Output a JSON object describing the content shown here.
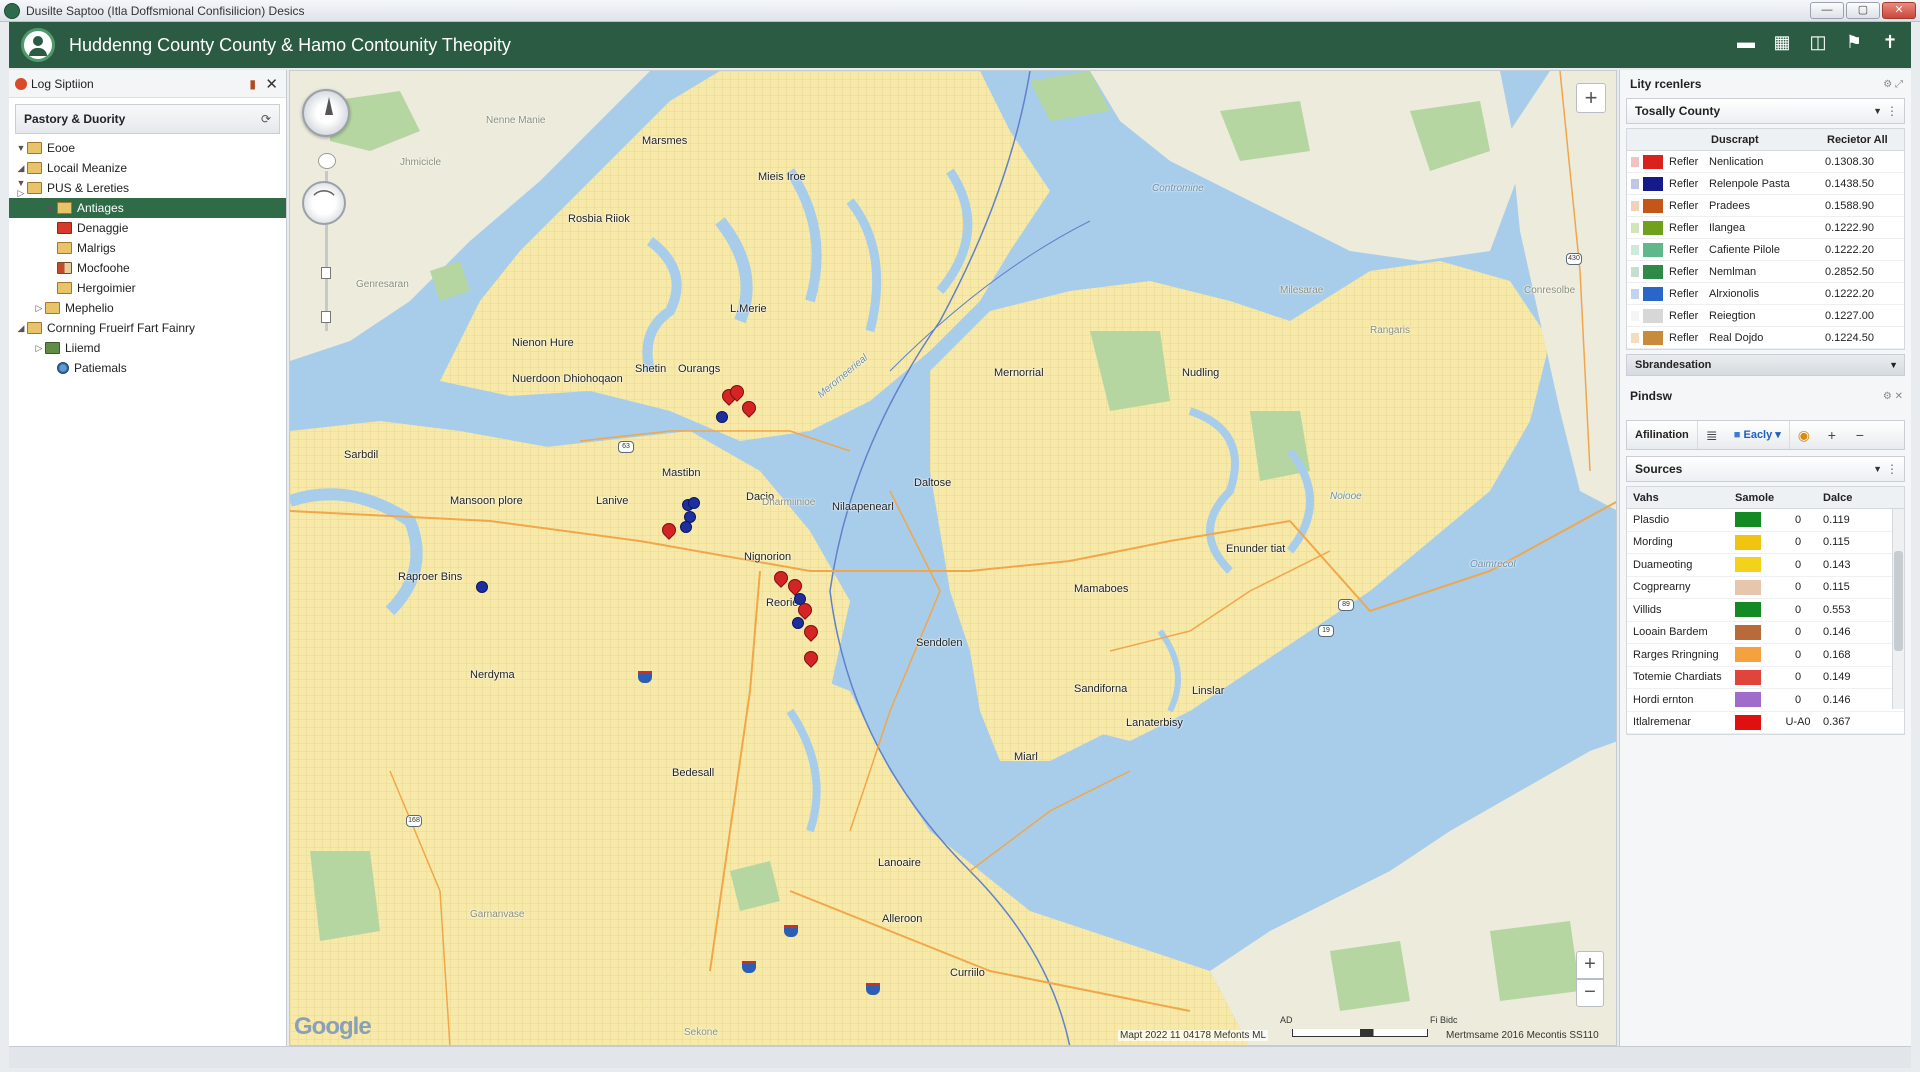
{
  "window": {
    "os_title": "Dusilte Saptoo (Itla Doffsmional Confisilicion) Desics",
    "app_title": "Huddenng County County & Hamo Contounity Theopity"
  },
  "header_tools": [
    "folder-icon",
    "grid-icon",
    "chart-icon",
    "flag-icon",
    "pin-icon"
  ],
  "left_panel": {
    "title": "Log Siptiion",
    "section": "Pastory & Duority",
    "tree": [
      {
        "label": "Eooe",
        "expand": "▼",
        "icon": "folder"
      },
      {
        "label": "Locail Meanize",
        "expand": "◢",
        "icon": "folder"
      },
      {
        "label": "PUS & Lereties",
        "expand": "▼ ▷",
        "icon": "folder"
      },
      {
        "label": "Antiages",
        "expand": "▶",
        "icon": "folder",
        "selected": true
      },
      {
        "label": "Denaggie",
        "expand": "",
        "icon": "red"
      },
      {
        "label": "Malrigs",
        "expand": "",
        "icon": "folder"
      },
      {
        "label": "Mocfoohe",
        "expand": "",
        "icon": "mixed"
      },
      {
        "label": "Hergoimier",
        "expand": "",
        "icon": "folder"
      },
      {
        "label": "Mephelio",
        "expand": "▷",
        "icon": "folder"
      },
      {
        "label": "Cornning Frueirf Fart Fainry",
        "expand": "◢",
        "icon": "folder"
      },
      {
        "label": "Liiemd",
        "expand": "▷",
        "icon": "green"
      },
      {
        "label": "Patiemals",
        "expand": "",
        "icon": "globe"
      }
    ]
  },
  "map": {
    "labels": {
      "marsmes": "Marsmes",
      "mieis_iroe": "Mieis Iroe",
      "roabia_riiok": "Rosbia Riiok",
      "l_merie": "L.Merie",
      "nienon_hire": "Nienon Hure",
      "shetin": "Shetin",
      "ourangs": "Ourangs",
      "nuerdoon": "Nuerdoon Dhiohoqaon",
      "sarbdil": "Sarbdil",
      "mastibn": "Mastibn",
      "mansoon_plore": "Mansoon plore",
      "lanive": "Lanive",
      "dacio": "Dacio",
      "nignorion": "Nignorion",
      "reorie": "Reorie",
      "raproer_bins": "Raproer Bins",
      "nerdyma": "Nerdyma",
      "bedesall": "Bedesall",
      "nilaapenearl": "Nilaapenearl",
      "daltose": "Daltose",
      "mernorrial": "Mernorrial",
      "nudling": "Nudling",
      "mamaboes": "Mamaboes",
      "sendolen": "Sendolen",
      "enunder_tiat": "Enunder tiat",
      "sandiforna": "Sandiforna",
      "linslar": "Linslar",
      "lanaterbisy": "Lanaterbisy",
      "miarl": "Miarl",
      "lanoaire": "Lanoaire",
      "alleroon": "Alleroon",
      "curriilo": "Curriilo",
      "water1": "Contromine",
      "water2": "Noiooe",
      "water3": "Oaimrecol",
      "faint1": "Nenne Manie",
      "faint2": "Genresaran",
      "faint3": "Milesarae",
      "faint4": "Conresolbe",
      "faint5": "Rangaris",
      "faint6": "Garnanvase",
      "faint7": "Dharmiinioe",
      "faint8": "Jhmicicle",
      "faint9": "Sekone",
      "river": "Merorneerieal"
    },
    "google": "Google",
    "attribution": "Mapt 2022 11 04178 Mefonts ML",
    "scale_left": "AD",
    "scale_right": "Fi Bidc",
    "attribution2": "Mertmsame 2016 Mecontis SS110",
    "compass_glyph": "⌒"
  },
  "right_panel": {
    "legend_title": "Lity rcenlers",
    "dropdown": "Tosally County",
    "table_headers": {
      "col1": "Duscrapt",
      "col2": "Recietor All"
    },
    "legend_rows": [
      {
        "kind": "Refler",
        "desc": "Nenlication",
        "value": "0.1308.30",
        "color": "#d9211e",
        "chk": "#e89a9a"
      },
      {
        "kind": "Refler",
        "desc": "Relenpole Pasta",
        "value": "0.1438.50",
        "color": "#151a8a",
        "chk": "#9aa0d6"
      },
      {
        "kind": "Refler",
        "desc": "Pradees",
        "value": "0.1588.90",
        "color": "#c4561a",
        "chk": "#eab08a"
      },
      {
        "kind": "Refler",
        "desc": "Ilangea",
        "value": "0.1222.90",
        "color": "#6fa01e",
        "chk": "#b6d38e"
      },
      {
        "kind": "Refler",
        "desc": "Cafiente Pilole",
        "value": "0.1222.20",
        "color": "#5fb88a",
        "chk": "#a8dcc2"
      },
      {
        "kind": "Refler",
        "desc": "Nemlman",
        "value": "0.2852.50",
        "color": "#2f8a4a",
        "chk": "#9ccaa8"
      },
      {
        "kind": "Refler",
        "desc": "Alrxionolis",
        "value": "0.1222.20",
        "color": "#2a66c8",
        "chk": "#9ab8ea"
      },
      {
        "kind": "Refler",
        "desc": "Reiegtion",
        "value": "0.1227.00",
        "color": "#d7d7d7",
        "chk": "#eeeeee"
      },
      {
        "kind": "Refler",
        "desc": "Real Dojdo",
        "value": "0.1224.50",
        "color": "#c98a3a",
        "chk": "#ecc690"
      }
    ],
    "blocked_label": "Sbrandesation",
    "pindsw_title": "Pindsw",
    "toolbar": {
      "affiliation": "Afilination",
      "list_icon": "≣",
      "early": "Eacly",
      "globe_icon": "◉",
      "plus": "+",
      "minus": "−"
    },
    "sources_dropdown": "Sources",
    "sources_headers": {
      "name": "Vahs",
      "sample": "Samole",
      "date": "Dalce"
    },
    "sources_rows": [
      {
        "name": "Plasdio",
        "color": "#138a24",
        "zero": "0",
        "value": "0.119"
      },
      {
        "name": "Mording",
        "color": "#f1c40f",
        "zero": "0",
        "value": "0.115"
      },
      {
        "name": "Duameoting",
        "color": "#f3d21c",
        "zero": "0",
        "value": "0.143"
      },
      {
        "name": "Cogprearny",
        "color": "#e6c7ad",
        "zero": "0",
        "value": "0.115"
      },
      {
        "name": "Villids",
        "color": "#138a24",
        "zero": "0",
        "value": "0.553"
      },
      {
        "name": "Looain Bardem",
        "color": "#b96a3a",
        "zero": "0",
        "value": "0.146"
      },
      {
        "name": "Rarges Rringning",
        "color": "#f5a23e",
        "zero": "0",
        "value": "0.168"
      },
      {
        "name": "Totemie Chardiats",
        "color": "#e0443a",
        "zero": "0",
        "value": "0.149"
      },
      {
        "name": "Hordi ernton",
        "color": "#a06ccc",
        "zero": "0",
        "value": "0.146"
      },
      {
        "name": "Itlalremenar",
        "color": "#e01010",
        "zero": "U-A0",
        "value": "0.367"
      }
    ]
  },
  "colors": {
    "header_green": "#2b5c43",
    "selected_green": "#2f6b47",
    "land": "#f5e7a6",
    "water": "#a8cdea",
    "park": "#b5d6a1"
  }
}
